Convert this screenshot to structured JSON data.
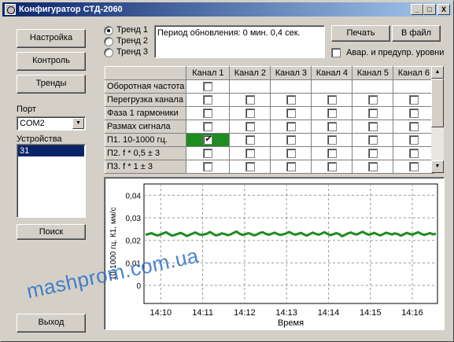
{
  "window": {
    "title": "Конфигуратор СТД-2060",
    "min_glyph": "_",
    "max_glyph": "□",
    "close_glyph": "X"
  },
  "left_panel": {
    "settings_button": "Настройка",
    "control_button": "Контроль",
    "trends_button": "Тренды",
    "port_label": "Порт",
    "port_value": "COM2",
    "devices_label": "Устройства",
    "devices": [
      "31"
    ],
    "search_button": "Поиск",
    "exit_button": "Выход"
  },
  "trend_select": {
    "options": [
      "Тренд 1",
      "Тренд 2",
      "Тренд 3"
    ],
    "selected_index": 0
  },
  "info_box": {
    "text": "Период обновления: 0 мин. 0,4 сек."
  },
  "actions": {
    "print_button": "Печать",
    "to_file_button": "В файл",
    "levels_checkbox_label": "Авар. и предупр. уровни",
    "levels_checked": false
  },
  "grid": {
    "columns": [
      "Канал 1",
      "Канал 2",
      "Канал 3",
      "Канал 4",
      "Канал 5",
      "Канал 6"
    ],
    "rows": [
      {
        "label": "Оборотная частота",
        "checks": [
          false,
          null,
          null,
          null,
          null,
          null
        ]
      },
      {
        "label": "Перегрузка канала",
        "checks": [
          false,
          false,
          false,
          false,
          false,
          false
        ]
      },
      {
        "label": "Фаза 1 гармоники",
        "checks": [
          false,
          false,
          false,
          false,
          false,
          false
        ]
      },
      {
        "label": "Размах сигнала",
        "checks": [
          false,
          false,
          false,
          false,
          false,
          false
        ]
      },
      {
        "label": "П1. 10-1000 гц.",
        "checks": [
          true,
          false,
          false,
          false,
          false,
          false
        ],
        "selected_col": 0
      },
      {
        "label": "П2. f * 0,5 ± 3",
        "checks": [
          false,
          false,
          false,
          false,
          false,
          false
        ]
      },
      {
        "label": "П3. f * 1 ± 3",
        "checks": [
          false,
          false,
          false,
          false,
          false,
          false
        ]
      }
    ]
  },
  "watermark": "mashprom.com.ua",
  "colors": {
    "titlebar_start": "#0a246a",
    "titlebar_end": "#a6caf0",
    "series": "#1e8c1e",
    "face": "#d4d0c8",
    "watermark": "#2a6fc9"
  },
  "chart_data": {
    "type": "line",
    "title": "",
    "xlabel": "Время",
    "ylabel": "10-1000 гц. К1, мм/с",
    "x_ticks": [
      "14:10",
      "14:11",
      "14:12",
      "14:13",
      "14:14",
      "14:15",
      "14:16"
    ],
    "y_ticks": [
      "0",
      "0,01",
      "0,02",
      "0,03",
      "0,04"
    ],
    "ylim": [
      -0.008,
      0.045
    ],
    "grid": true,
    "series": [
      {
        "values": [
          0.0225,
          0.0228,
          0.0232,
          0.0226,
          0.0222,
          0.0225,
          0.0231,
          0.0236,
          0.0228,
          0.0221,
          0.0224,
          0.0229,
          0.0233,
          0.0227,
          0.0219,
          0.0224,
          0.023,
          0.0235,
          0.0228,
          0.0224,
          0.0226,
          0.023,
          0.0237,
          0.0229,
          0.0222,
          0.0225,
          0.0231,
          0.0228,
          0.0223,
          0.0226,
          0.0233,
          0.0239,
          0.023,
          0.0224,
          0.0227,
          0.0232,
          0.0228,
          0.0222,
          0.0226,
          0.0233,
          0.0236,
          0.0229,
          0.0225,
          0.0229,
          0.0234,
          0.0228,
          0.0224,
          0.0227,
          0.0231,
          0.0237,
          0.023,
          0.0225,
          0.0229,
          0.0233,
          0.0226,
          0.0221,
          0.0228,
          0.0234,
          0.0229,
          0.0225,
          0.023,
          0.0236,
          0.0229,
          0.0223,
          0.0227,
          0.0232,
          0.0228,
          0.0218,
          0.0224,
          0.0231,
          0.0235,
          0.0229,
          0.0226,
          0.0232,
          0.0238,
          0.0231,
          0.0225,
          0.0228,
          0.0233,
          0.0227,
          0.0222,
          0.0227,
          0.0234,
          0.023,
          0.0226,
          0.0231,
          0.0228,
          0.0221,
          0.0226,
          0.0233,
          0.0229,
          0.0225,
          0.0231,
          0.0236,
          0.0229,
          0.0224,
          0.0228,
          0.0232,
          0.0227,
          0.0229
        ]
      }
    ]
  }
}
